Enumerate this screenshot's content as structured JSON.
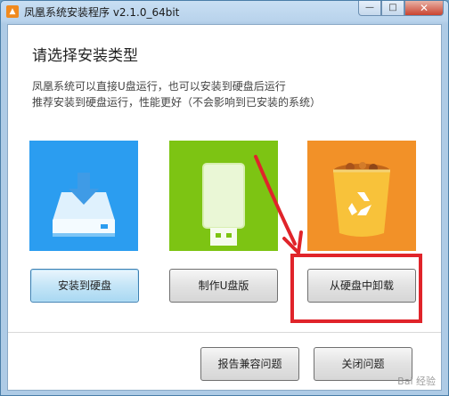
{
  "window": {
    "title": "凤凰系统安装程序 v2.1.0_64bit",
    "controls": {
      "minimize": "—",
      "maximize": "□",
      "close": "✕"
    }
  },
  "main": {
    "heading": "请选择安装类型",
    "desc_line1": "凤凰系统可以直接U盘运行，也可以安装到硬盘后运行",
    "desc_line2": "推荐安装到硬盘运行，性能更好（不会影响到已安装的系统）"
  },
  "options": [
    {
      "label": "安装到硬盘",
      "icon": "hard-drive-download-icon",
      "color": "#2b9df0"
    },
    {
      "label": "制作U盘版",
      "icon": "usb-drive-icon",
      "color": "#7dc413"
    },
    {
      "label": "从硬盘中卸载",
      "icon": "recycle-bin-icon",
      "color": "#f29128"
    }
  ],
  "footer": {
    "report_label": "报告兼容问题",
    "close_label": "关闭问题"
  },
  "annotation": {
    "color": "#e0242a"
  },
  "watermark": "Bai 经验"
}
